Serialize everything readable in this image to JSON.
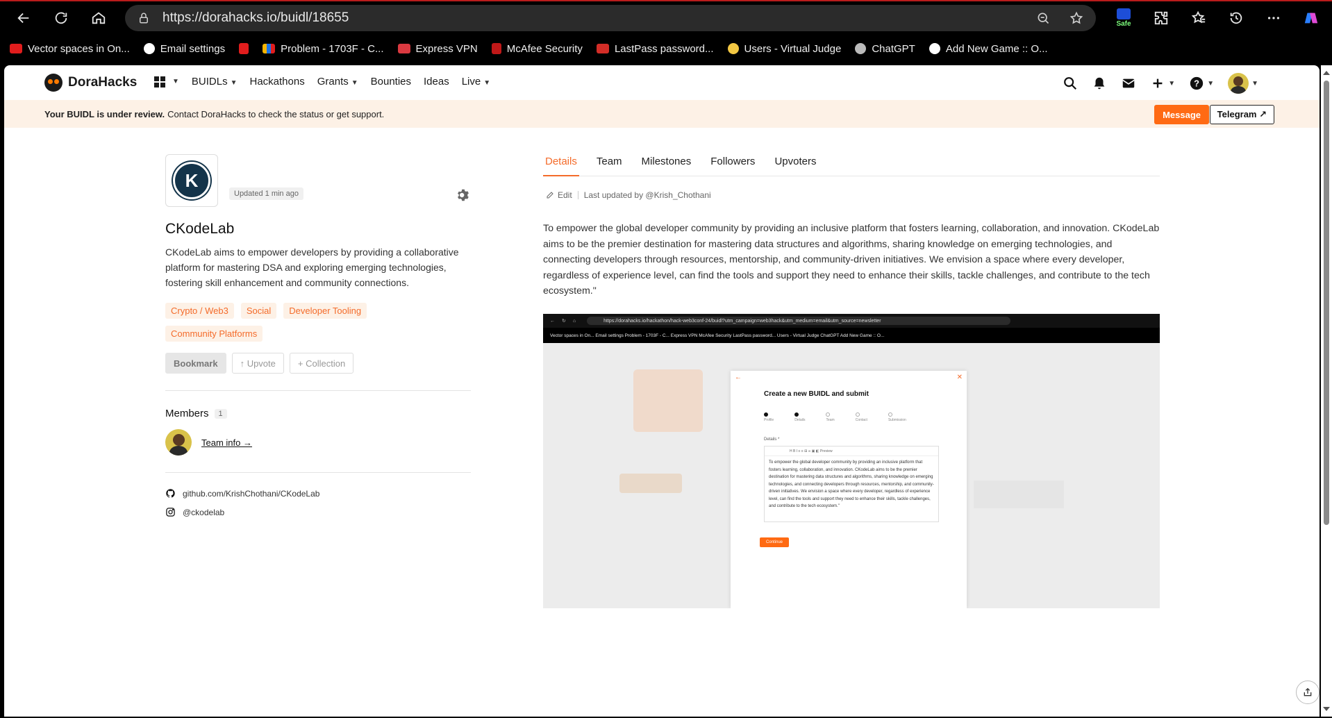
{
  "browser": {
    "url": "https://dorahacks.io/buidl/18655",
    "safe_label": "Safe",
    "bookmarks": [
      {
        "label": "Vector spaces in On...",
        "color": "#e11d1d"
      },
      {
        "label": "Email settings",
        "color": "#ffffff"
      },
      {
        "label": "",
        "color": "#e11d1d"
      },
      {
        "label": "Problem - 1703F - C...",
        "color": "#f5b400"
      },
      {
        "label": "Express VPN",
        "color": "#da3940"
      },
      {
        "label": "McAfee Security",
        "color": "#c01818"
      },
      {
        "label": "LastPass password...",
        "color": "#d32d27"
      },
      {
        "label": "Users - Virtual Judge",
        "color": "#f3c843"
      },
      {
        "label": "ChatGPT",
        "color": "#bbbbbb"
      },
      {
        "label": "Add New Game :: O...",
        "color": "#ffffff"
      }
    ]
  },
  "site": {
    "brand": "DoraHacks",
    "menu": [
      {
        "label": "BUIDLs",
        "caret": true
      },
      {
        "label": "Hackathons",
        "caret": false
      },
      {
        "label": "Grants",
        "caret": true
      },
      {
        "label": "Bounties",
        "caret": false
      },
      {
        "label": "Ideas",
        "caret": false
      },
      {
        "label": "Live",
        "caret": true
      }
    ]
  },
  "banner": {
    "bold": "Your BUIDL is under review.",
    "text": "Contact DoraHacks to check the status or get support.",
    "message_button": "Message",
    "telegram_button": "Telegram ↗"
  },
  "project": {
    "logo_letter": "K",
    "updated": "Updated 1 min ago",
    "title": "CKodeLab",
    "description": "CKodeLab aims to empower developers by providing a collaborative platform for mastering DSA and exploring emerging technologies, fostering skill enhancement and community connections.",
    "tags": [
      "Crypto / Web3",
      "Social",
      "Developer Tooling",
      "Community Platforms"
    ],
    "actions": {
      "bookmark": "Bookmark",
      "upvote": "↑ Upvote",
      "collection": "+ Collection"
    },
    "members_title": "Members",
    "members_count": "1",
    "team_info": "Team info →",
    "github": "github.com/KrishChothani/CKodeLab",
    "instagram": "@ckodelab"
  },
  "tabs": [
    {
      "label": "Details",
      "active": true
    },
    {
      "label": "Team",
      "active": false
    },
    {
      "label": "Milestones",
      "active": false
    },
    {
      "label": "Followers",
      "active": false
    },
    {
      "label": "Upvoters",
      "active": false
    }
  ],
  "details": {
    "edit": "Edit",
    "last_updated": "Last updated by @Krish_Chothani",
    "body": "To empower the global developer community by providing an inclusive platform that fosters learning, collaboration, and innovation. CKodeLab aims to be the premier destination for mastering data structures and algorithms, sharing knowledge on emerging technologies, and connecting developers through resources, mentorship, and community-driven initiatives. We envision a space where every developer, regardless of experience level, can find the tools and support they need to enhance their skills, tackle challenges, and contribute to the tech ecosystem.\""
  },
  "embedded_screenshot": {
    "url": "https://dorahacks.io/hackathon/hack-web3conf-24/buidl?utm_campaign=web3hack&utm_medium=email&utm_source=newsletter",
    "bookmarks": "Vector spaces in On...   Email settings   Problem - 1703F - C...   Express VPN   McAfee Security   LastPass password...   Users - Virtual Judge   ChatGPT   Add New Game :: O...",
    "modal_title": "Create a new BUIDL and submit",
    "steps": [
      "Profile",
      "Details",
      "Team",
      "Contact",
      "Submission"
    ],
    "details_label": "Details *",
    "toolbar": "H  B  I  ≡  ≡  ⊞  ∞  ▣  ◧   Preview",
    "text": "To empower the global developer community by providing an inclusive platform that fosters learning, collaboration, and innovation. CKodeLab aims to be the premier destination for mastering data structures and algorithms, sharing knowledge on emerging technologies, and connecting developers through resources, mentorship, and community-driven initiatives. We envision a space where every developer, regardless of experience level, can find the tools and support they need to enhance their skills, tackle challenges, and contribute to the tech ecosystem.\"",
    "continue": "Continue"
  }
}
